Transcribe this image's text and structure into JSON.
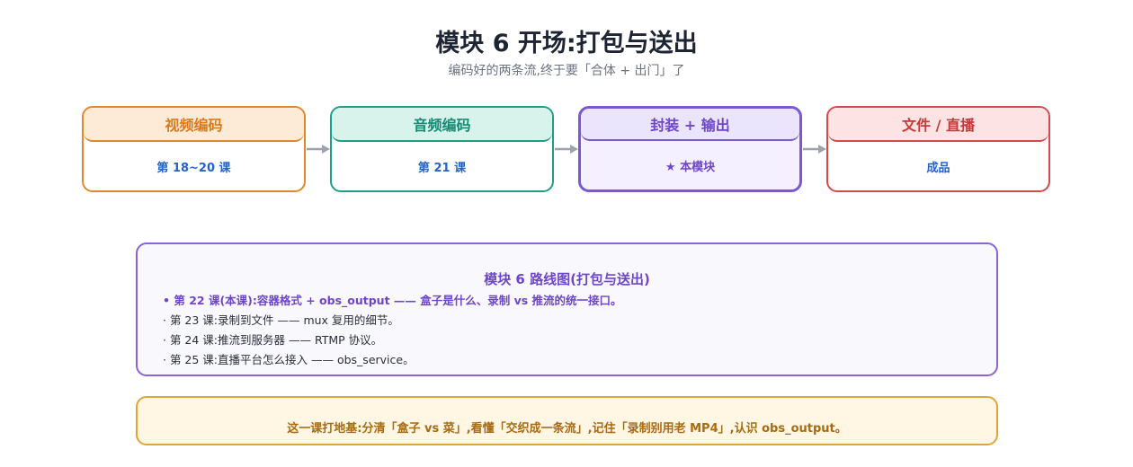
{
  "header": {
    "title": "模块 6 开场:打包与送出",
    "subtitle": "编码好的两条流,终于要「合体 + 出门」了"
  },
  "pipeline": [
    {
      "label": "视频编码",
      "detail": "第 18~20 课"
    },
    {
      "label": "音频编码",
      "detail": "第 21 课"
    },
    {
      "label": "封装 + 输出",
      "detail": "★ 本模块"
    },
    {
      "label": "文件 / 直播",
      "detail": "成品"
    }
  ],
  "colors": {
    "video": "#e0892b",
    "audio": "#1e9e86",
    "mux": "#7c57d4",
    "output": "#d24a4a",
    "summary": "#e0a53a",
    "arrow": "#9ca3af"
  },
  "roadmap": {
    "title": "模块 6 路线图(打包与送出)",
    "items": [
      "• 第 22 课(本课):容器格式 + obs_output —— 盒子是什么、录制 vs 推流的统一接口。",
      "· 第 23 课:录制到文件 —— mux 复用的细节。",
      "· 第 24 课:推流到服务器 —— RTMP 协议。",
      "· 第 25 课:直播平台怎么接入 —— obs_service。"
    ]
  },
  "summary": {
    "text": "这一课打地基:分清「盒子 vs 菜」,看懂「交织成一条流」,记住「录制别用老 MP4」,认识 obs_output。"
  }
}
